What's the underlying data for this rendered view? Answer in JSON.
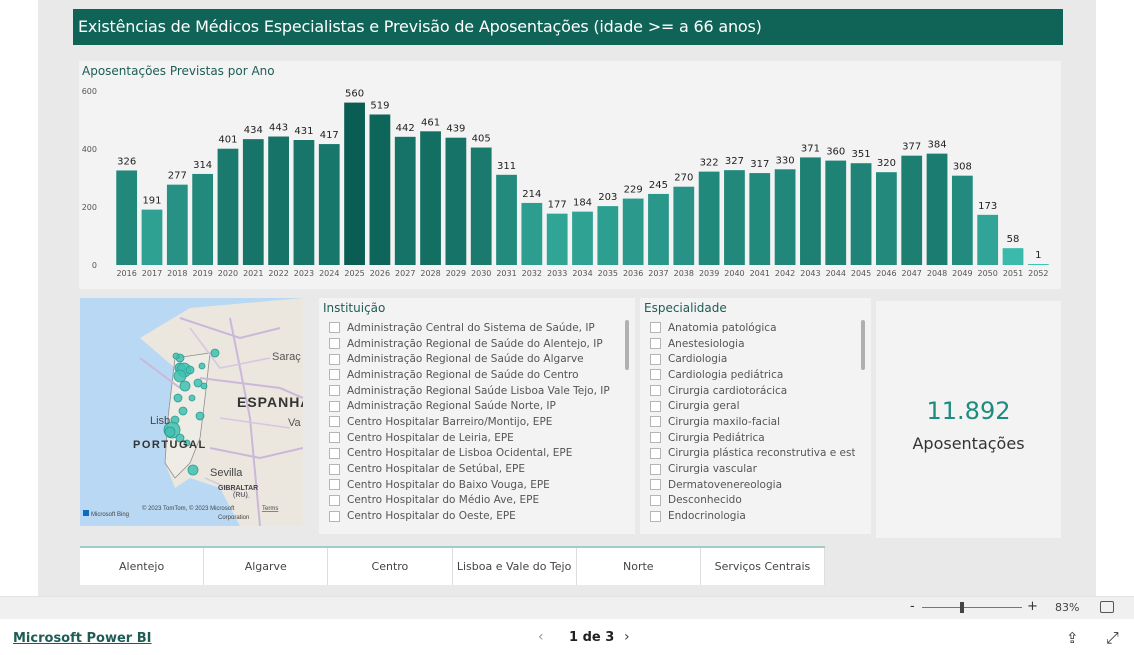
{
  "report": {
    "title": "Existências de Médicos Especialistas e Previsão de Aposentações (idade >= a 66 anos)"
  },
  "chart_data": {
    "type": "bar",
    "title": "Aposentações Previstas por Ano",
    "categories": [
      "2016",
      "2017",
      "2018",
      "2019",
      "2020",
      "2021",
      "2022",
      "2023",
      "2024",
      "2025",
      "2026",
      "2027",
      "2028",
      "2029",
      "2030",
      "2031",
      "2032",
      "2033",
      "2034",
      "2035",
      "2036",
      "2037",
      "2038",
      "2039",
      "2040",
      "2041",
      "2042",
      "2043",
      "2044",
      "2045",
      "2046",
      "2047",
      "2048",
      "2049",
      "2050",
      "2051",
      "2052"
    ],
    "values": [
      326,
      191,
      277,
      314,
      401,
      434,
      443,
      431,
      417,
      560,
      519,
      442,
      461,
      439,
      405,
      311,
      214,
      177,
      184,
      203,
      229,
      245,
      270,
      322,
      327,
      317,
      330,
      371,
      360,
      351,
      320,
      377,
      384,
      308,
      173,
      58,
      1
    ],
    "ylim": [
      0,
      600
    ],
    "yticks": [
      0,
      200,
      400,
      600
    ],
    "grid": false,
    "color_low": "#41c4b4",
    "color_high": "#0a5d52"
  },
  "map": {
    "labels": {
      "spain": "ESPANHA",
      "portugal": "PORTUGAL",
      "zaragoza": "Saraç",
      "lisboa": "Lisb",
      "sevilla": "Sevilla",
      "gibraltar": "GIBRALTAR",
      "gibraltar_sub": "(RU)",
      "valencia": "Va",
      "attribution": "© 2023 TomTom, © 2023 Microsoft",
      "attribution2": "Corporation",
      "terms": "Terms",
      "bing": "Microsoft Bing"
    }
  },
  "slicers": {
    "institution": {
      "title": "Instituição",
      "items": [
        "Administração Central do Sistema de Saúde, IP",
        "Administração Regional de Saúde do Alentejo, IP",
        "Administração Regional de Saúde do Algarve",
        "Administração Regional de Saúde do Centro",
        "Administração Regional Saúde Lisboa Vale Tejo, IP",
        "Administração Regional Saúde Norte, IP",
        "Centro Hospitalar Barreiro/Montijo, EPE",
        "Centro Hospitalar de Leiria, EPE",
        "Centro Hospitalar de Lisboa Ocidental, EPE",
        "Centro Hospitalar de Setúbal, EPE",
        "Centro Hospitalar do Baixo Vouga, EPE",
        "Centro Hospitalar do Médio Ave, EPE",
        "Centro Hospitalar do Oeste, EPE"
      ]
    },
    "specialty": {
      "title": "Especialidade",
      "items": [
        "Anatomia patológica",
        "Anestesiologia",
        "Cardiologia",
        "Cardiologia pediátrica",
        "Cirurgia cardiotorácica",
        "Cirurgia geral",
        "Cirurgia maxilo-facial",
        "Cirurgia Pediátrica",
        "Cirurgia plástica reconstrutiva e estética",
        "Cirurgia vascular",
        "Dermatovenereologia",
        "Desconhecido",
        "Endocrinologia"
      ]
    }
  },
  "kpi": {
    "value": "11.892",
    "label": "Aposentações"
  },
  "regions": [
    "Alentejo",
    "Algarve",
    "Centro",
    "Lisboa e Vale do Tejo",
    "Norte",
    "Serviços Centrais"
  ],
  "status": {
    "zoom_minus": "-",
    "zoom_plus": "+",
    "zoom": "83%",
    "zoom_level": 0.4
  },
  "footer": {
    "link": "Microsoft Power BI",
    "page": "1 de 3",
    "prev": "‹",
    "next": "›",
    "share_icon": "share-icon",
    "expand_icon": "expand-icon"
  }
}
